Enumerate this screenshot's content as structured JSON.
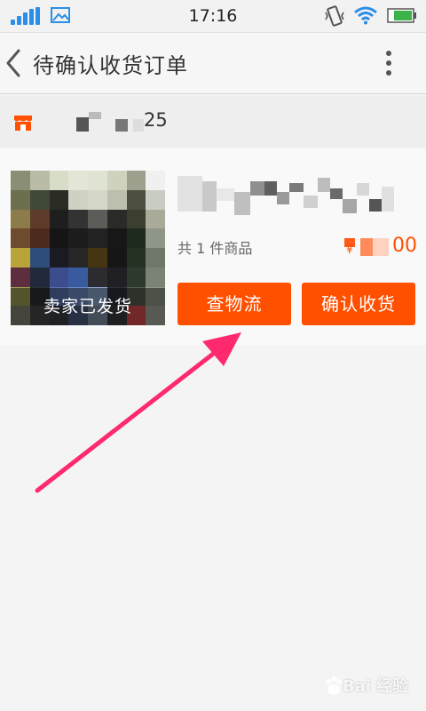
{
  "status_bar": {
    "time": "17:16",
    "icons": [
      "signal-icon",
      "image-icon",
      "vibrate-icon",
      "wifi-icon",
      "battery-icon"
    ],
    "accent_color": "#2b8ee8",
    "battery_color": "#3cb34a"
  },
  "header": {
    "title": "待确认收货订单",
    "back_icon": "chevron-left-icon",
    "more_icon": "more-vertical-icon"
  },
  "shop": {
    "icon": "shop-icon",
    "name_visible": "25",
    "icon_color": "#ff5000"
  },
  "order": {
    "badge": "卖家已发货",
    "item_count": "共 1 件商品",
    "price_currency": "¥",
    "price_value": "00",
    "buttons": {
      "logistics": "查物流",
      "confirm": "确认收货"
    },
    "accent_color": "#ff5000"
  },
  "annotation": {
    "arrow_color": "#ff2a6d"
  },
  "watermark": {
    "text": "Bai 经验"
  }
}
